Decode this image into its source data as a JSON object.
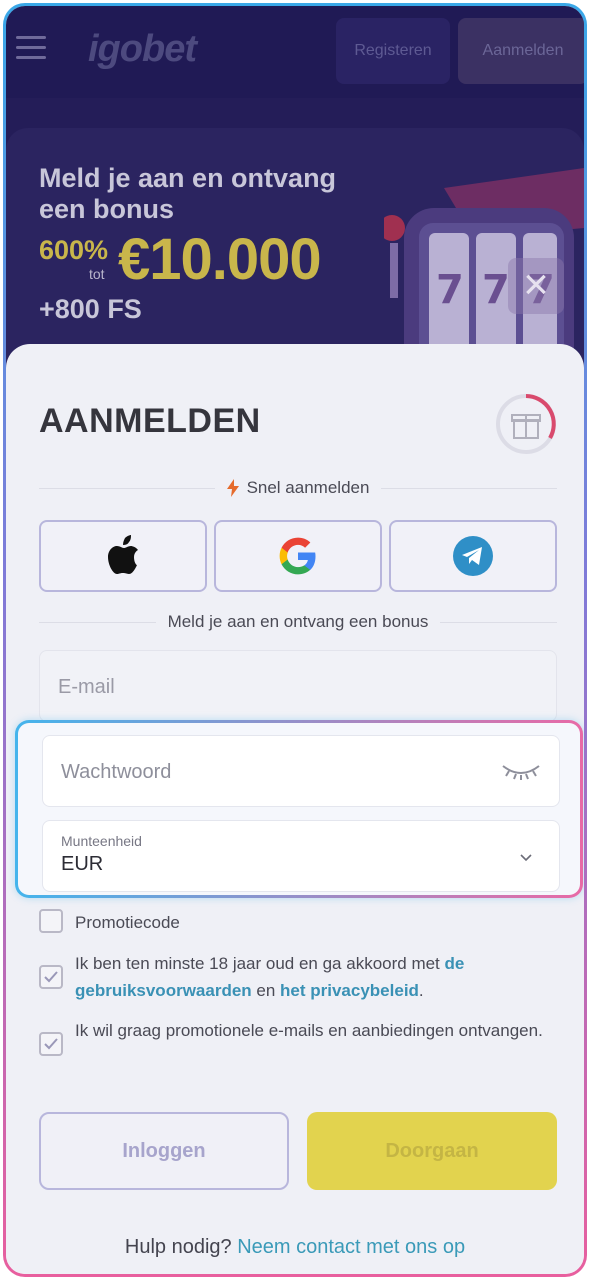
{
  "header": {
    "logo_text": "igobet",
    "register_label": "Registeren",
    "login_label": "Aanmelden"
  },
  "banner": {
    "title": "Meld je aan en ontvang een bonus",
    "percent": "600%",
    "tot": "tot",
    "amount": "€10.000",
    "free_spins": "+800 FS"
  },
  "form": {
    "title": "AANMELDEN",
    "quick_login": "Snel aanmelden",
    "social": [
      "apple-icon",
      "google-icon",
      "telegram-icon"
    ],
    "bonus_divider": "Meld je aan en ontvang een bonus",
    "email_placeholder": "E-mail",
    "password_placeholder": "Wachtwoord",
    "currency_label": "Munteenheid",
    "currency_value": "EUR",
    "promo_label": "Promotiecode",
    "terms_prefix": "Ik ben ten minste 18 jaar oud en ga akkoord met ",
    "terms_link": "de gebruiksvoorwaarden",
    "terms_mid": " en ",
    "privacy_link": "het privacybeleid",
    "terms_end": ".",
    "marketing_label": "Ik wil graag promotionele e-mails en aanbiedingen ontvangen.",
    "login_button": "Inloggen",
    "continue_button": "Doorgaan",
    "help_text": "Hulp nodig?",
    "help_link": "Neem contact met ons op"
  },
  "checkbox_state": {
    "promo": false,
    "terms": true,
    "marketing": true
  },
  "colors": {
    "accent_yellow": "#e2d34e",
    "link_blue": "#3a91b5",
    "header_bg": "#201a55",
    "highlight_gradient": [
      "#44b4ec",
      "#e86aa6"
    ]
  }
}
